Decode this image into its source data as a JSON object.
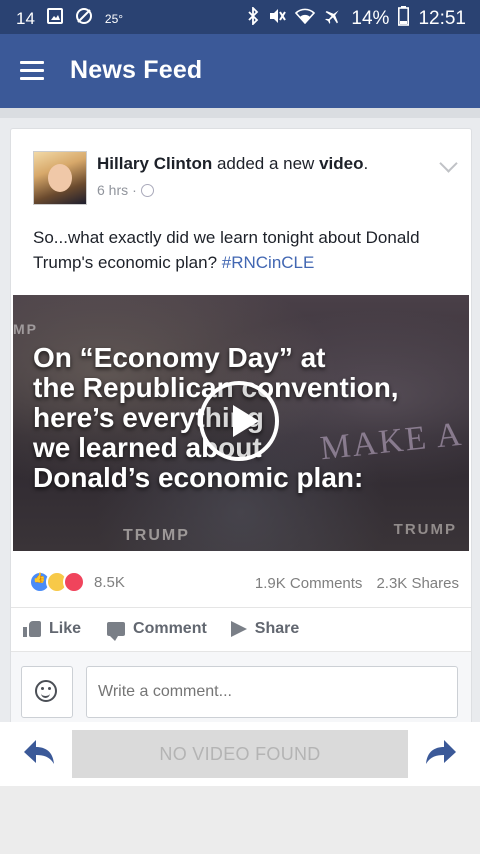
{
  "statusbar": {
    "left_number": "14",
    "temperature": "25°",
    "battery_percent": "14%",
    "time": "12:51"
  },
  "appbar": {
    "title": "News Feed",
    "color": "#3b5998"
  },
  "post": {
    "author": "Hillary Clinton",
    "action_text": "added a new",
    "object_text": "video",
    "trailing": ".",
    "time_ago": "6 hrs",
    "separator": "·",
    "body_text": "So...what exactly did we learn tonight about Donald Trump's economic plan? ",
    "hashtag": "#RNCinCLE",
    "video": {
      "lines": [
        "On “Economy Day” at",
        "the Republican convention,",
        "here’s everything",
        "we learned about",
        "Donald’s economic plan:"
      ],
      "background_signs": {
        "make_a": "MAKE A",
        "trump_bottom": "TRUMP",
        "trump_right": "TRUMP",
        "mp_left": "MP"
      }
    },
    "reactions": {
      "icons": [
        "like-reaction",
        "haha-reaction",
        "love-reaction"
      ],
      "count": "8.5K"
    },
    "comments_count": "1.9K Comments",
    "shares_count": "2.3K Shares",
    "actions": {
      "like": "Like",
      "comment": "Comment",
      "share": "Share"
    },
    "comment_placeholder": "Write a comment..."
  },
  "bottombar": {
    "no_video_label": "NO VIDEO FOUND",
    "arrow_color": "#3b5998"
  }
}
